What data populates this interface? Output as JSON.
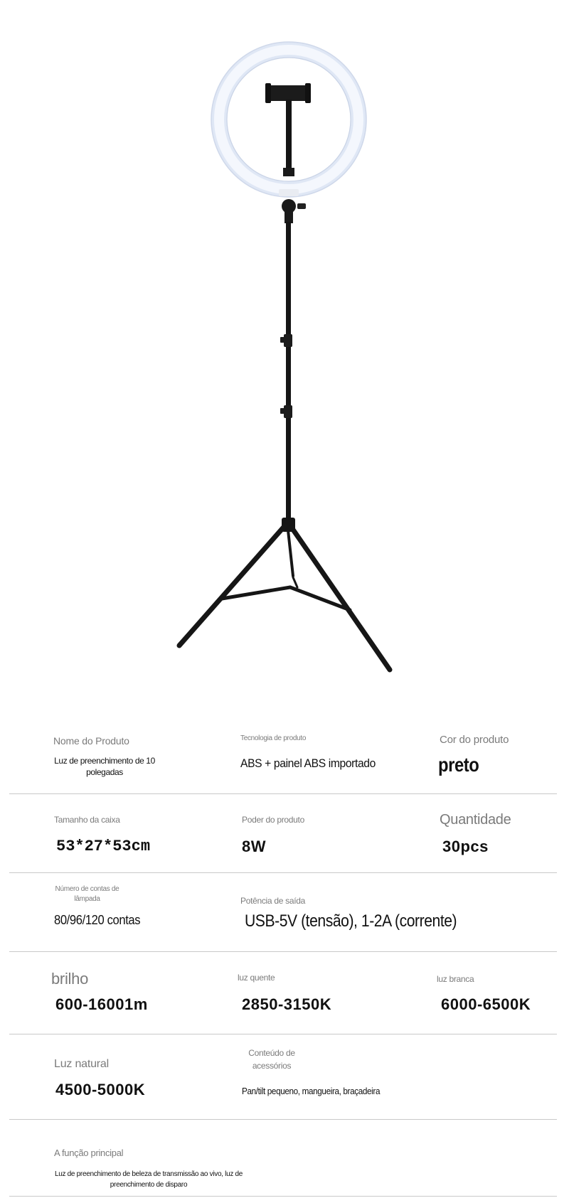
{
  "specs": {
    "row1": {
      "nome_label": "Nome do Produto",
      "nome_value": "Luz de preenchimento de 10 polegadas",
      "tecnologia_label": "Tecnologia de produto",
      "tecnologia_value": "ABS + painel ABS importado",
      "cor_label": "Cor do produto",
      "cor_value": "preto"
    },
    "row2": {
      "caixa_label": "Tamanho da caixa",
      "caixa_value": "53*27*53cm",
      "poder_label": "Poder do produto",
      "poder_value": "8W",
      "quantidade_label": "Quantidade",
      "quantidade_value": "30pcs"
    },
    "row3": {
      "contas_label": "Número de contas de lâmpada",
      "contas_value": "80/96/120 contas",
      "potencia_label": "Potência de saída",
      "potencia_value": "USB-5V (tensão), 1-2A (corrente)"
    },
    "row4": {
      "brilho_label": "brilho",
      "brilho_value": "600-16001m",
      "quente_label": "luz quente",
      "quente_value": "2850-3150K",
      "branca_label": "luz branca",
      "branca_value": "6000-6500K"
    },
    "row5": {
      "natural_label": "Luz natural",
      "natural_value": "4500-5000K",
      "acessorios_label": "Conteúdo de acessórios",
      "acessorios_value": "Pan/tilt pequeno, mangueira, braçadeira"
    },
    "row6": {
      "funcao_label": "A função principal",
      "funcao_value": "Luz de preenchimento de beleza de transmissão ao vivo, luz de preenchimento de disparo"
    }
  }
}
